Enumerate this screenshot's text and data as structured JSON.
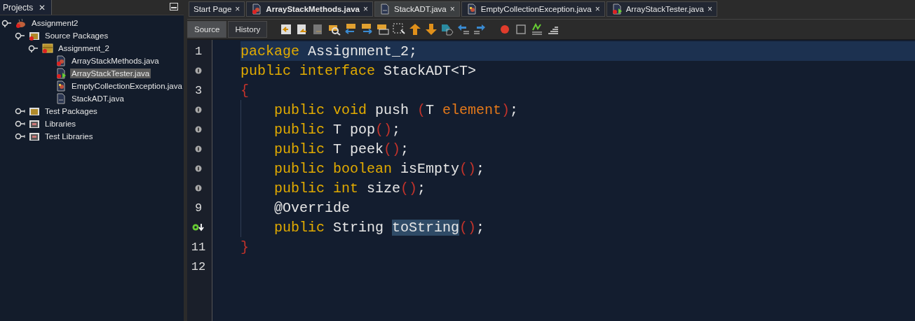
{
  "projects_panel": {
    "title": "Projects",
    "close": "✕",
    "tree": [
      {
        "label": "Assignment2",
        "kind": "project",
        "expanded": true,
        "selected": false,
        "children": [
          {
            "label": "Source Packages",
            "kind": "source-folder",
            "expanded": true,
            "selected": false,
            "children": [
              {
                "label": "Assignment_2",
                "kind": "package",
                "expanded": true,
                "selected": false,
                "children": [
                  {
                    "label": "ArrayStackMethods.java",
                    "kind": "error-class",
                    "selected": false
                  },
                  {
                    "label": "ArrayStackTester.java",
                    "kind": "error-main",
                    "selected": true
                  },
                  {
                    "label": "EmptyCollectionException.java",
                    "kind": "class",
                    "selected": false
                  },
                  {
                    "label": "StackADT.java",
                    "kind": "interface",
                    "selected": false
                  }
                ]
              }
            ]
          },
          {
            "label": "Test Packages",
            "kind": "test-folder",
            "expanded": false,
            "selected": false
          },
          {
            "label": "Libraries",
            "kind": "library",
            "expanded": false,
            "selected": false
          },
          {
            "label": "Test Libraries",
            "kind": "library",
            "expanded": false,
            "selected": false
          }
        ]
      }
    ]
  },
  "editor_tabs": [
    {
      "label": "Start Page",
      "kind": "page",
      "modified": false,
      "selected": false,
      "close": "×"
    },
    {
      "label": "ArrayStackMethods.java",
      "kind": "error-class",
      "modified": true,
      "selected": false,
      "close": "×"
    },
    {
      "label": "StackADT.java",
      "kind": "interface",
      "modified": false,
      "selected": true,
      "close": "×"
    },
    {
      "label": "EmptyCollectionException.java",
      "kind": "class",
      "modified": false,
      "selected": false,
      "close": "×"
    },
    {
      "label": "ArrayStackTester.java",
      "kind": "error-main",
      "modified": false,
      "selected": false,
      "close": "×"
    }
  ],
  "view_buttons": [
    {
      "label": "Source",
      "selected": true
    },
    {
      "label": "History",
      "selected": false
    }
  ],
  "code_lines": [
    {
      "kind": "numbered",
      "number": "1",
      "current": true,
      "indented": false,
      "tokens": [
        {
          "kind": "keyword",
          "text": "package"
        },
        {
          "kind": "plain",
          "text": " Assignment_2;"
        }
      ]
    },
    {
      "kind": "implements",
      "current": false,
      "indented": false,
      "tokens": [
        {
          "kind": "keyword",
          "text": "public interface"
        },
        {
          "kind": "plain",
          "text": " StackADT<T>"
        }
      ]
    },
    {
      "kind": "numbered",
      "number": "3",
      "current": false,
      "indented": false,
      "tokens": [
        {
          "kind": "paren",
          "text": "{"
        }
      ]
    },
    {
      "kind": "implements",
      "current": false,
      "indented": true,
      "tokens": [
        {
          "kind": "keyword",
          "text": "public void"
        },
        {
          "kind": "plain",
          "text": " push "
        },
        {
          "kind": "paren",
          "text": "("
        },
        {
          "kind": "plain",
          "text": "T "
        },
        {
          "kind": "param",
          "text": "element"
        },
        {
          "kind": "paren",
          "text": ")"
        },
        {
          "kind": "plain",
          "text": ";"
        }
      ]
    },
    {
      "kind": "implements",
      "current": false,
      "indented": true,
      "tokens": [
        {
          "kind": "keyword",
          "text": "public"
        },
        {
          "kind": "plain",
          "text": " T pop"
        },
        {
          "kind": "paren",
          "text": "()"
        },
        {
          "kind": "plain",
          "text": ";"
        }
      ]
    },
    {
      "kind": "implements",
      "current": false,
      "indented": true,
      "tokens": [
        {
          "kind": "keyword",
          "text": "public"
        },
        {
          "kind": "plain",
          "text": " T peek"
        },
        {
          "kind": "paren",
          "text": "()"
        },
        {
          "kind": "plain",
          "text": ";"
        }
      ]
    },
    {
      "kind": "implements",
      "current": false,
      "indented": true,
      "tokens": [
        {
          "kind": "keyword",
          "text": "public boolean"
        },
        {
          "kind": "plain",
          "text": " isEmpty"
        },
        {
          "kind": "paren",
          "text": "()"
        },
        {
          "kind": "plain",
          "text": ";"
        }
      ]
    },
    {
      "kind": "implements",
      "current": false,
      "indented": true,
      "tokens": [
        {
          "kind": "keyword",
          "text": "public int"
        },
        {
          "kind": "plain",
          "text": " size"
        },
        {
          "kind": "paren",
          "text": "()"
        },
        {
          "kind": "plain",
          "text": ";"
        }
      ]
    },
    {
      "kind": "numbered",
      "number": "9",
      "current": false,
      "indented": true,
      "tokens": [
        {
          "kind": "plain",
          "text": "@Override"
        }
      ]
    },
    {
      "kind": "overrides",
      "current": false,
      "indented": true,
      "tokens": [
        {
          "kind": "keyword",
          "text": "public"
        },
        {
          "kind": "plain",
          "text": " String "
        },
        {
          "kind": "match",
          "text": "toString"
        },
        {
          "kind": "paren",
          "text": "()"
        },
        {
          "kind": "plain",
          "text": ";"
        }
      ]
    },
    {
      "kind": "numbered",
      "number": "11",
      "current": false,
      "indented": false,
      "tokens": [
        {
          "kind": "paren",
          "text": "}"
        }
      ]
    },
    {
      "kind": "numbered",
      "number": "12"
    }
  ]
}
